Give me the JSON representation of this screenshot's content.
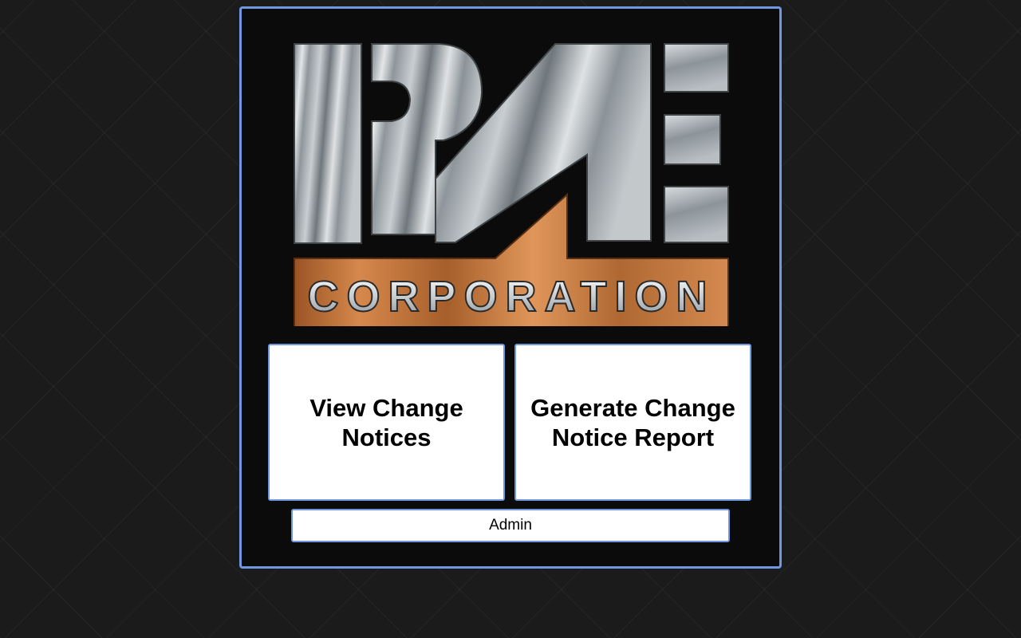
{
  "logo": {
    "wordmark": "CORPORATION",
    "colors": {
      "steel_light": "#d9dde0",
      "steel_dark": "#6d7479",
      "copper_light": "#d98a4e",
      "copper_dark": "#8a4a1e"
    }
  },
  "actions": {
    "view_change_notices": "View Change Notices",
    "generate_report": "Generate Change Notice Report",
    "admin": "Admin"
  },
  "theme": {
    "accent": "#6f98e0",
    "panel_bg": "#0b0b0b",
    "page_bg": "#1b1b1b"
  }
}
